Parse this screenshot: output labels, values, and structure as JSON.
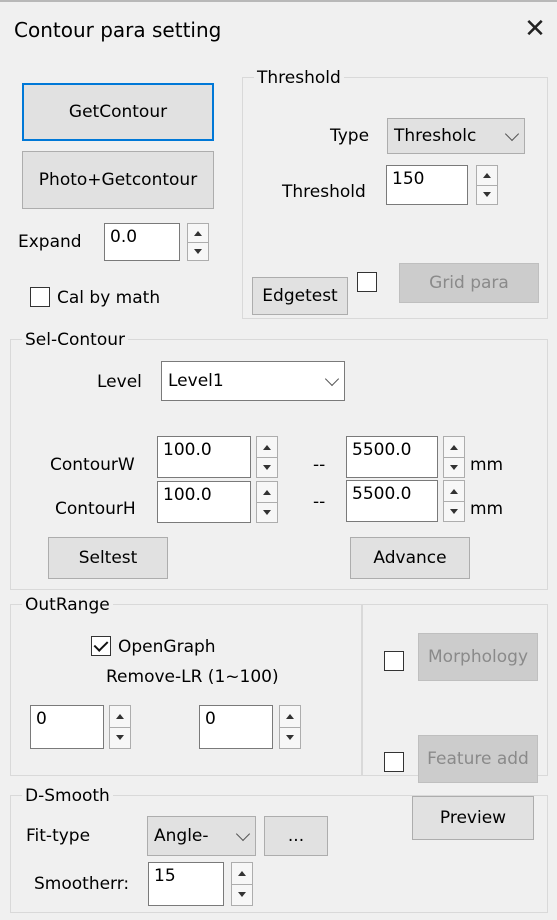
{
  "window": {
    "title": "Contour para setting",
    "close_symbol": "✕"
  },
  "top": {
    "get_contour": "GetContour",
    "photo_get_contour": "Photo+Getcontour",
    "expand_label": "Expand",
    "expand_value": "0.0",
    "cal_by_math": "Cal by math",
    "cal_by_math_checked": false
  },
  "threshold": {
    "group_label": "Threshold",
    "type_label": "Type",
    "type_value": "Thresholc",
    "threshold_label": "Threshold",
    "threshold_value": "150",
    "edgetest": "Edgetest",
    "edgetest_checked": false,
    "grid_para": "Grid para"
  },
  "sel_contour": {
    "group_label": "Sel-Contour",
    "level_label": "Level",
    "level_value": "Level1",
    "contour_w_label": "ContourW",
    "contour_w_min": "100.0",
    "contour_w_max": "5500.0",
    "contour_h_label": "ContourH",
    "contour_h_min": "100.0",
    "contour_h_max": "5500.0",
    "range_sep": "--",
    "unit": "mm",
    "seltest": "Seltest",
    "advance": "Advance"
  },
  "out_range": {
    "group_label": "OutRange",
    "open_graph": "OpenGraph",
    "open_graph_checked": true,
    "remove_lr": "Remove-LR  (1~100)",
    "left_value": "0",
    "right_value": "0",
    "morphology": "Morphology",
    "morphology_checked": false,
    "feature_add": "Feature add",
    "feature_add_checked": false
  },
  "d_smooth": {
    "group_label": "D-Smooth",
    "fit_type_label": "Fit-type",
    "fit_type_value": "Angle-",
    "more": "...",
    "preview": "Preview",
    "smootherr_label": "Smootherr:",
    "smootherr_value": "15"
  }
}
